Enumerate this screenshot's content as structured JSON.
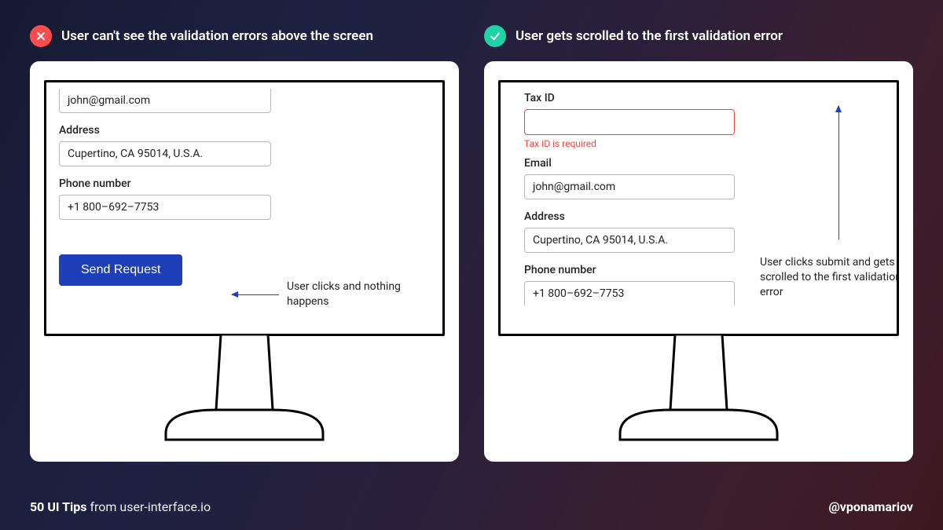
{
  "left": {
    "heading": "User can't see the validation errors above the screen",
    "form": {
      "email_value": "john@gmail.com",
      "address_label": "Address",
      "address_value": "Cupertino, CA 95014, U.S.A.",
      "phone_label": "Phone number",
      "phone_value": "+1 800–692–7753",
      "submit_label": "Send Request"
    },
    "annotation": "User clicks and nothing happens"
  },
  "right": {
    "heading": "User gets scrolled to the first validation error",
    "form": {
      "taxid_label": "Tax ID",
      "taxid_error": "Tax ID is required",
      "email_label": "Email",
      "email_value": "john@gmail.com",
      "address_label": "Address",
      "address_value": "Cupertino, CA 95014, U.S.A.",
      "phone_label": "Phone number",
      "phone_value": "+1 800–692–7753"
    },
    "annotation": "User clicks submit and gets scrolled to the first validation error"
  },
  "footer": {
    "brand": "50 UI Tips",
    "from": " from user-interface.io",
    "handle": "@vponamariov"
  }
}
